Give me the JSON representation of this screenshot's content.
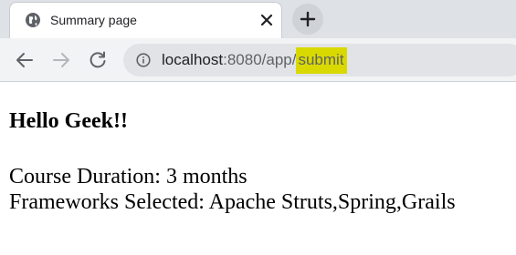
{
  "browser": {
    "tab": {
      "title": "Summary page",
      "favicon": "globe-icon",
      "close_icon": "close-icon"
    },
    "new_tab_icon": "plus-icon",
    "nav": {
      "back_icon": "arrow-left-icon",
      "forward_icon": "arrow-right-icon",
      "reload_icon": "reload-icon"
    },
    "address_bar": {
      "info_icon": "info-icon",
      "host": "localhost",
      "path_prefix": ":8080/app/",
      "path_highlighted": "submit",
      "highlight_color": "#d9d900"
    }
  },
  "page": {
    "heading": "Hello Geek!!",
    "lines": [
      "Course Duration: 3 months",
      "Frameworks Selected: Apache Struts,Spring,Grails"
    ]
  }
}
